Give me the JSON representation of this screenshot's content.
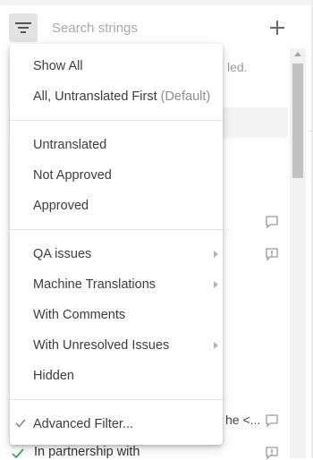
{
  "header": {
    "search_placeholder": "Search strings",
    "filter_icon": "filter-lines-icon",
    "add_icon": "plus-icon"
  },
  "background_list": {
    "hint_text": "led.",
    "partial_row_text": "he <...",
    "partial_item_text": "In partnership with"
  },
  "filter_menu": {
    "show_all": "Show All",
    "untranslated_first": "All, Untranslated First",
    "untranslated_first_suffix": "(Default)",
    "untranslated": "Untranslated",
    "not_approved": "Not Approved",
    "approved": "Approved",
    "qa_issues": "QA issues",
    "machine_translations": "Machine Translations",
    "with_comments": "With Comments",
    "with_unresolved_issues": "With Unresolved Issues",
    "hidden": "Hidden",
    "advanced_filter": "Advanced Filter...",
    "advanced_filter_checked": true
  },
  "colors": {
    "check_green": "#3aa65a",
    "icon_gray": "#9a9a9a",
    "filter_button_bg": "#e3e3e3"
  }
}
